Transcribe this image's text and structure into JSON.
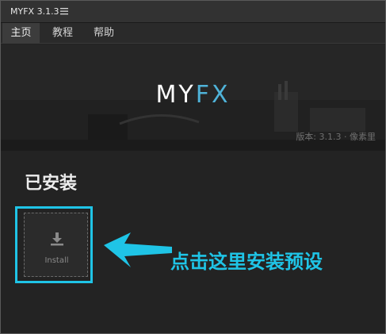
{
  "window": {
    "title": "MYFX 3.1.3"
  },
  "tabs": [
    {
      "label": "主页",
      "active": true
    },
    {
      "label": "教程",
      "active": false
    },
    {
      "label": "帮助",
      "active": false
    }
  ],
  "banner": {
    "logo_part1": "MY",
    "logo_part2": "FX",
    "version_text": "版本: 3.1.3 · 像素里"
  },
  "installed": {
    "title": "已安装",
    "install_label": "Install"
  },
  "annotation": {
    "text": "点击这里安装预设"
  },
  "colors": {
    "accent": "#1fc4e6",
    "logo_blue": "#4fb3d9",
    "background": "#232323"
  },
  "icons": {
    "menu": "hamburger-icon",
    "install": "download-icon"
  }
}
